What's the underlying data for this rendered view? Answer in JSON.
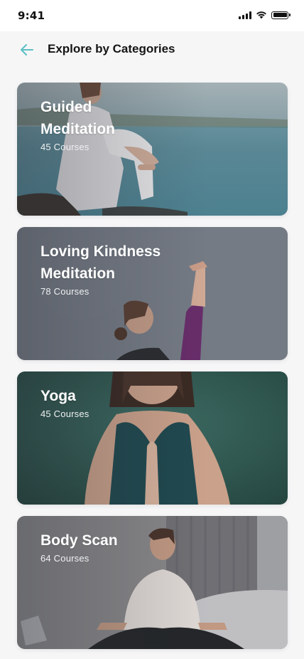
{
  "status_bar": {
    "time": "9:41",
    "icons": [
      "cellular-signal-icon",
      "wifi-icon",
      "battery-icon"
    ]
  },
  "header": {
    "back_icon": "arrow-left-icon",
    "title": "Explore by Categories"
  },
  "colors": {
    "accent": "#5bbfc4",
    "background": "#f6f6f7",
    "title_text": "#151515"
  },
  "categories": [
    {
      "title_line1": "Guided",
      "title_line2": "Meditation",
      "count": "45 Courses"
    },
    {
      "title_line1": "Loving Kindness",
      "title_line2": "Meditation",
      "count": "78 Courses"
    },
    {
      "title": "Yoga",
      "count": "45 Courses"
    },
    {
      "title": "Body Scan",
      "count": "64 Courses"
    }
  ]
}
